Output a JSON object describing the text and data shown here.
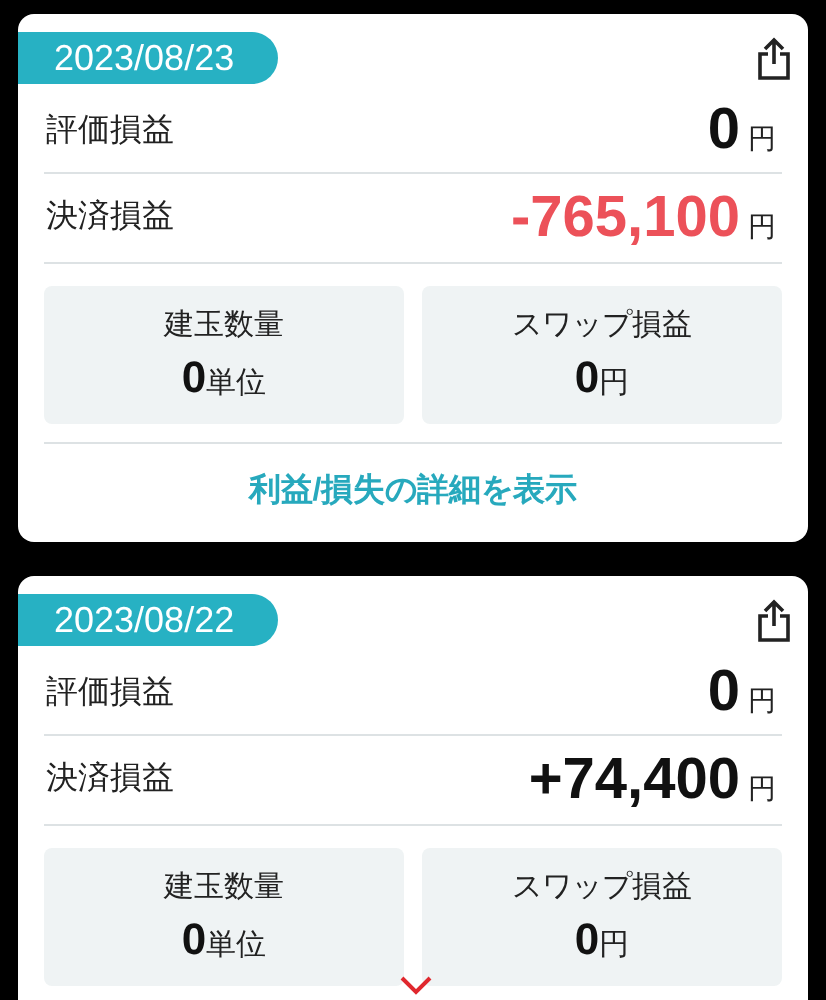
{
  "cards": [
    {
      "date": "2023/08/23",
      "rows": [
        {
          "label": "評価損益",
          "value": "0",
          "unit": "円",
          "negative": false
        },
        {
          "label": "決済損益",
          "value": "-765,100",
          "unit": "円",
          "negative": true
        }
      ],
      "stats": [
        {
          "label": "建玉数量",
          "value": "0",
          "unit": "単位"
        },
        {
          "label": "スワップ損益",
          "value": "0",
          "unit": "円"
        }
      ],
      "link": "利益/損失の詳細を表示"
    },
    {
      "date": "2023/08/22",
      "rows": [
        {
          "label": "評価損益",
          "value": "0",
          "unit": "円",
          "negative": false
        },
        {
          "label": "決済損益",
          "value": "+74,400",
          "unit": "円",
          "negative": false
        }
      ],
      "stats": [
        {
          "label": "建玉数量",
          "value": "0",
          "unit": "単位"
        },
        {
          "label": "スワップ損益",
          "value": "0",
          "unit": "円"
        }
      ]
    }
  ]
}
